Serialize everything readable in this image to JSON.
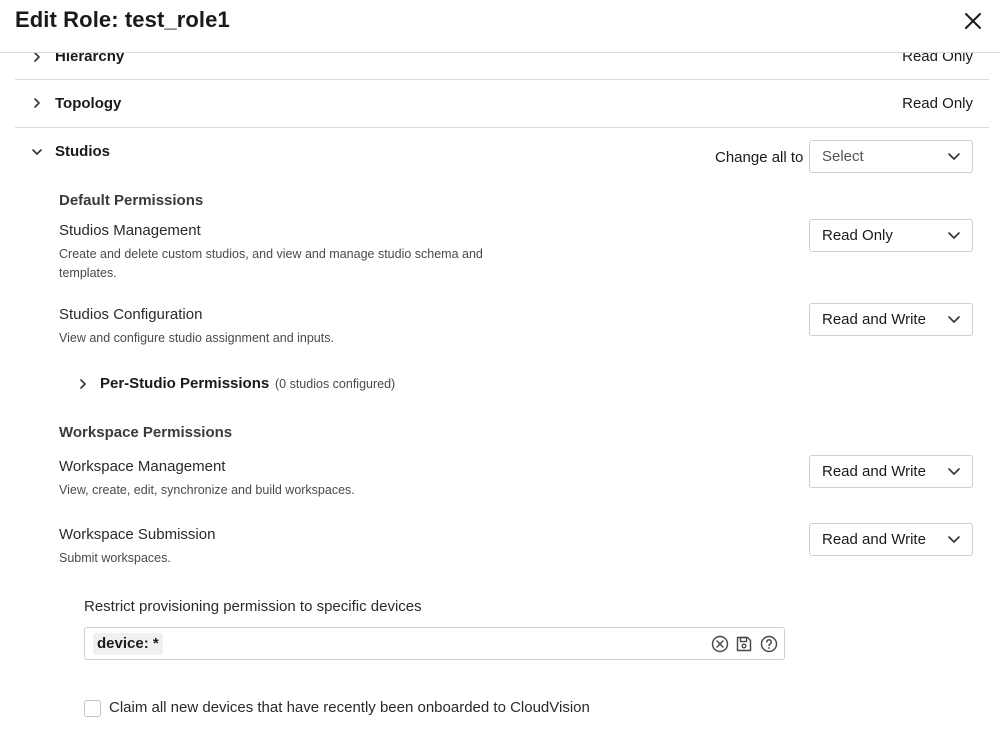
{
  "header": {
    "title": "Edit Role: test_role1"
  },
  "sections": {
    "hierarchy": {
      "label": "Hierarchy",
      "value": "Read Only"
    },
    "topology": {
      "label": "Topology",
      "value": "Read Only"
    },
    "studios": {
      "label": "Studios",
      "change_all_label": "Change all to",
      "change_all_value": "Select"
    }
  },
  "default_permissions": {
    "heading": "Default Permissions",
    "studios_management": {
      "title": "Studios Management",
      "description": "Create and delete custom studios, and view and manage studio schema and templates.",
      "value": "Read Only"
    },
    "studios_configuration": {
      "title": "Studios Configuration",
      "description": "View and configure studio assignment and inputs.",
      "value": "Read and Write"
    }
  },
  "per_studio": {
    "label": "Per-Studio Permissions",
    "count_text": "(0 studios configured)"
  },
  "workspace_permissions": {
    "heading": "Workspace Permissions",
    "management": {
      "title": "Workspace Management",
      "description": "View, create, edit, synchronize and build workspaces.",
      "value": "Read and Write"
    },
    "submission": {
      "title": "Workspace Submission",
      "description": "Submit workspaces.",
      "value": "Read and Write"
    }
  },
  "restrict": {
    "label": "Restrict provisioning permission to specific devices",
    "query": "device: *"
  },
  "claim": {
    "label": "Claim all new devices that have recently been onboarded to CloudVision",
    "checked": false
  },
  "icons": {
    "close": "close-icon",
    "chevron_right": "chevron-right-icon",
    "chevron_down": "chevron-down-icon",
    "clear": "clear-circle-icon",
    "save": "save-icon",
    "help": "help-icon"
  }
}
